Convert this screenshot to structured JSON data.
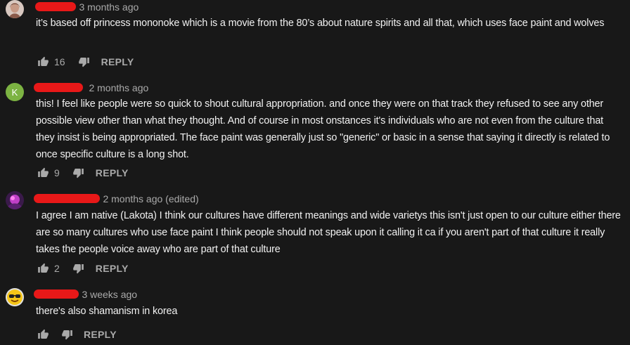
{
  "comments": [
    {
      "time": "3 months ago",
      "text": "it’s based off princess mononoke which is a movie from the 80’s about nature spirits and all that, which uses face paint and wolves",
      "likes": "16",
      "reply_label": "REPLY",
      "avatar": "photo"
    },
    {
      "time": "2 months ago",
      "text": "this! I feel like people were so quick to shout cultural appropriation. and once they were on that track they refused to see any other possible view other than what they thought.  And of course in most onstances it's individuals who are not even from the culture that they insist is being appropriated. The face paint was generally just so \"generic\" or basic in a sense that saying it directly is related to once specific culture is a long shot.",
      "likes": "9",
      "reply_label": "REPLY",
      "avatar": "letter",
      "avatar_letter": "K",
      "avatar_color": "#7cb342"
    },
    {
      "time": "2 months ago (edited)",
      "text": "I agree I am native (Lakota) I think our cultures have different meanings and wide varietys this isn't just open to our culture either there are so many cultures who use face paint I think people should not speak upon it calling it ca if you aren't part of that culture it really takes the people voice away who are part of that culture",
      "likes": "2",
      "reply_label": "REPLY",
      "avatar": "photo"
    },
    {
      "time": "3 weeks ago",
      "text": "there's also shamanism in korea",
      "likes": "",
      "reply_label": "REPLY",
      "avatar": "emoji"
    }
  ],
  "icons": {
    "like": "thumbs-up-icon",
    "dislike": "thumbs-down-icon"
  },
  "colors": {
    "background": "#181818",
    "text": "#f1f1f1",
    "secondary": "#aaaaaa",
    "redaction": "#e81818"
  }
}
